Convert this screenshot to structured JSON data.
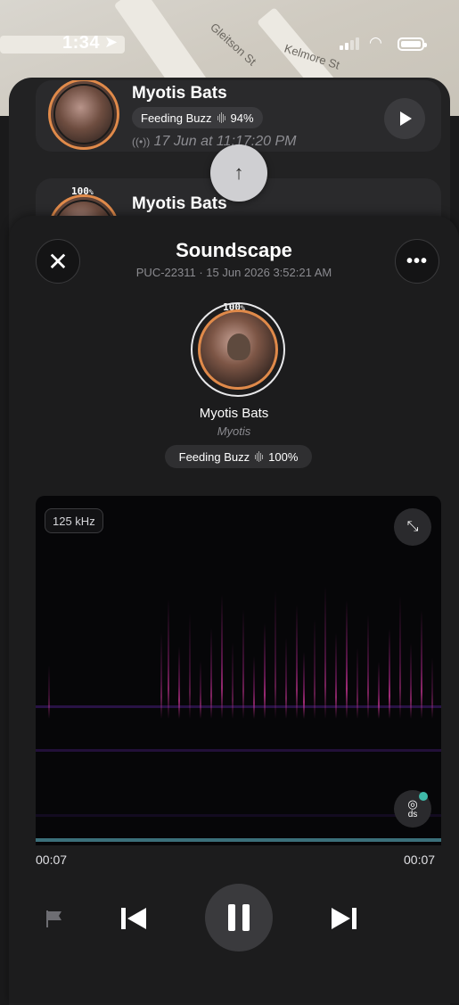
{
  "status_bar": {
    "time": "1:34",
    "location_icon": "location-arrow-icon",
    "signal_icon": "signal-icon",
    "wifi_icon": "wifi-icon",
    "battery_icon": "battery-icon"
  },
  "map": {
    "streets": [
      "Gleitson St",
      "Kelmore St"
    ]
  },
  "history_cards": [
    {
      "title": "Myotis Bats",
      "badge_label": "Feeding Buzz",
      "badge_pct": "94%",
      "time": "17 Jun at 11:17:20 PM"
    },
    {
      "title": "Myotis Bats",
      "confidence": "100",
      "confidence_unit": "%"
    }
  ],
  "sheet": {
    "title": "Soundscape",
    "subtitle": "PUC-22311 · 15 Jun 2026 3:52:21 AM",
    "confidence": "100",
    "confidence_unit": "%",
    "species": "Myotis Bats",
    "latin": "Myotis",
    "badge_label": "Feeding Buzz",
    "badge_pct": "100%"
  },
  "spectrogram": {
    "frequency_label": "125 kHz",
    "ds_label": "ds",
    "colors": {
      "accent": "#d03aa0",
      "track": "#3b6f7a",
      "ring": "#e08a4a"
    }
  },
  "player": {
    "elapsed": "00:07",
    "duration": "00:07",
    "progress": 1.0
  }
}
